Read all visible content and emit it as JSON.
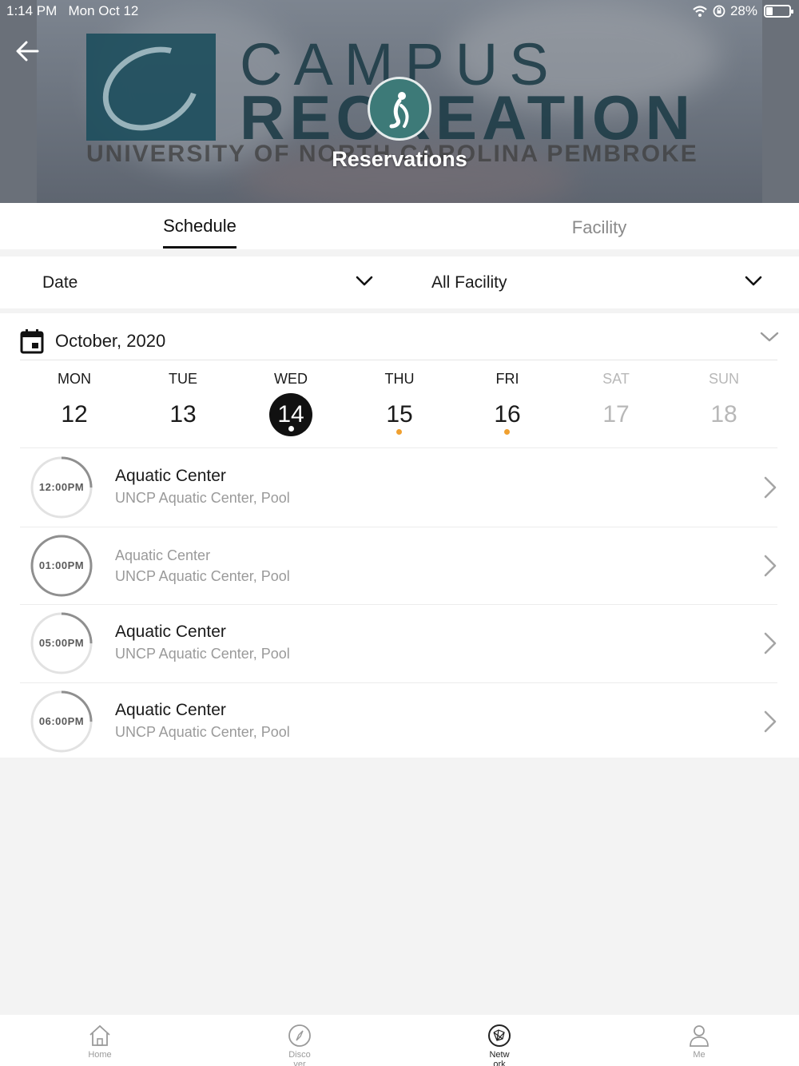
{
  "status_bar": {
    "time": "1:14 PM",
    "date": "Mon Oct 12",
    "battery": "28%",
    "battery_level": 0.28,
    "icons": [
      "wifi-icon",
      "orientation-lock-icon",
      "battery-icon"
    ]
  },
  "header": {
    "title": "Reservations",
    "logo_line1": "CAMPUS",
    "logo_line2": "RECREATION",
    "logo_line3": "UNIVERSITY OF NORTH CAROLINA PEMBROKE",
    "back_icon": "arrow-left-icon"
  },
  "tabs": [
    {
      "label": "Schedule",
      "active": true
    },
    {
      "label": "Facility",
      "active": false
    }
  ],
  "filters": {
    "date_label": "Date",
    "facility_label": "All Facility"
  },
  "calendar": {
    "month_label": "October,  2020",
    "days": [
      {
        "name": "MON",
        "num": "12",
        "has_event": false,
        "selected": false,
        "weekend": false
      },
      {
        "name": "TUE",
        "num": "13",
        "has_event": false,
        "selected": false,
        "weekend": false
      },
      {
        "name": "WED",
        "num": "14",
        "has_event": true,
        "selected": true,
        "weekend": false
      },
      {
        "name": "THU",
        "num": "15",
        "has_event": true,
        "selected": false,
        "weekend": false
      },
      {
        "name": "FRI",
        "num": "16",
        "has_event": true,
        "selected": false,
        "weekend": false
      },
      {
        "name": "SAT",
        "num": "17",
        "has_event": false,
        "selected": false,
        "weekend": true
      },
      {
        "name": "SUN",
        "num": "18",
        "has_event": false,
        "selected": false,
        "weekend": true
      }
    ]
  },
  "sessions": [
    {
      "time": "12:00PM",
      "name": "Aquatic Center",
      "location": "UNCP Aquatic Center, Pool",
      "fill": 0.25,
      "muted": false
    },
    {
      "time": "01:00PM",
      "name": "Aquatic Center",
      "location": "UNCP Aquatic Center, Pool",
      "fill": 1.0,
      "muted": true
    },
    {
      "time": "05:00PM",
      "name": "Aquatic Center",
      "location": "UNCP Aquatic Center, Pool",
      "fill": 0.25,
      "muted": false
    },
    {
      "time": "06:00PM",
      "name": "Aquatic Center",
      "location": "UNCP Aquatic Center, Pool",
      "fill": 0.25,
      "muted": false
    }
  ],
  "bottom_nav": [
    {
      "label": "Home",
      "icon": "home-icon",
      "active": false
    },
    {
      "label": "Disco\nver",
      "icon": "compass-icon",
      "active": false
    },
    {
      "label": "Netw\nork",
      "icon": "network-icon",
      "active": true
    },
    {
      "label": "Me",
      "icon": "person-icon",
      "active": false
    }
  ],
  "colors": {
    "accent_dot": "#f0a030",
    "selected_day": "#111111",
    "banner_teal": "#1f4f5e"
  }
}
